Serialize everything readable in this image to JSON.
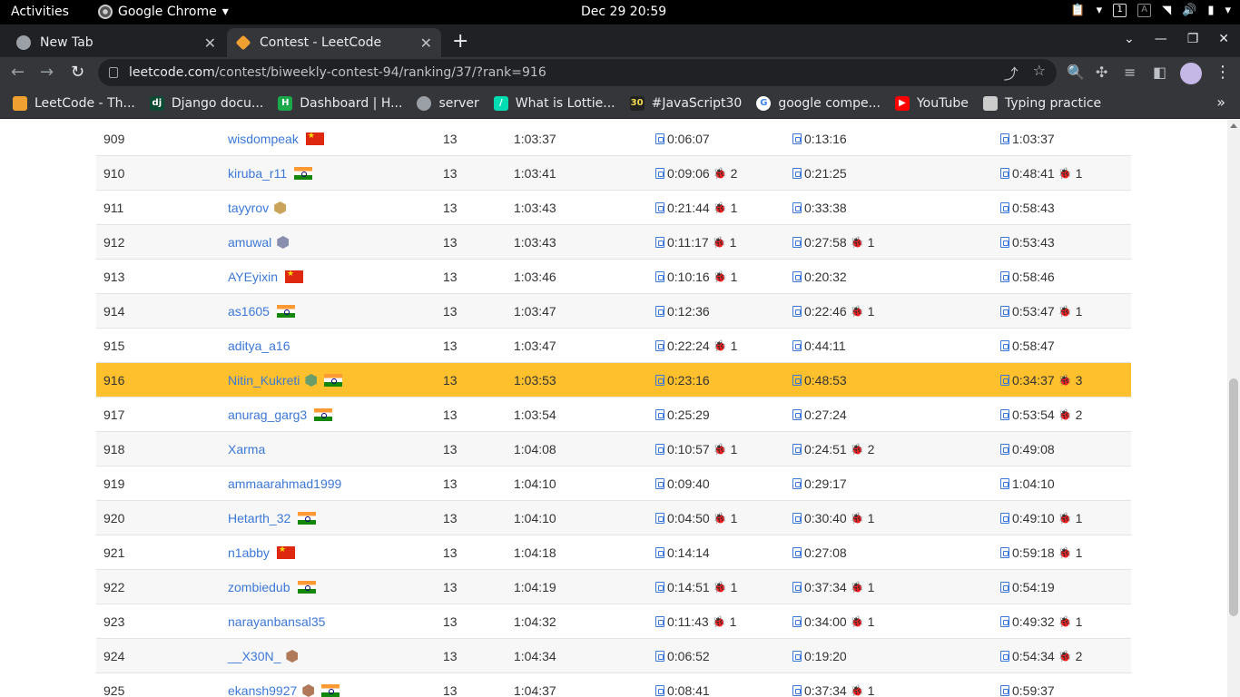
{
  "system_bar": {
    "activities": "Activities",
    "app_name": "Google Chrome",
    "clock": "Dec 29  20:59"
  },
  "tabs": [
    {
      "title": "New Tab"
    },
    {
      "title": "Contest - LeetCode"
    }
  ],
  "address_bar": {
    "host": "leetcode.com",
    "path": "/contest/biweekly-contest-94/ranking/37/?rank=916"
  },
  "bookmarks": [
    {
      "label": "LeetCode - Th...",
      "icon": "leetcode-icon",
      "color": "#f0a030"
    },
    {
      "label": "Django docu...",
      "icon": "django-icon",
      "color": "#0c4b33"
    },
    {
      "label": "Dashboard | H...",
      "icon": "hackerrank-icon",
      "color": "#1ba94c"
    },
    {
      "label": "server",
      "icon": "globe-icon",
      "color": "#9aa0a6"
    },
    {
      "label": "What is Lottie...",
      "icon": "lottie-icon",
      "color": "#00ddb3"
    },
    {
      "label": "#JavaScript30",
      "icon": "js30-icon",
      "color": "#222"
    },
    {
      "label": "google compe...",
      "icon": "google-icon",
      "color": "#ffffff"
    },
    {
      "label": "YouTube",
      "icon": "youtube-icon",
      "color": "#ff0000"
    },
    {
      "label": "Typing practice",
      "icon": "typing-icon",
      "color": "#cccccc"
    }
  ],
  "ranking": [
    {
      "rank": "909",
      "user": "wisdompeak",
      "flag": "cn",
      "badge": "",
      "score": "13",
      "finish": "1:03:37",
      "q1": "0:06:07",
      "q1_bugs": "",
      "q2": "0:13:16",
      "q2_bugs": "",
      "q3": "1:03:37",
      "q3_bugs": ""
    },
    {
      "rank": "910",
      "user": "kiruba_r11",
      "flag": "in",
      "badge": "",
      "score": "13",
      "finish": "1:03:41",
      "q1": "0:09:06",
      "q1_bugs": "2",
      "q2": "0:21:25",
      "q2_bugs": "",
      "q3": "0:48:41",
      "q3_bugs": "1"
    },
    {
      "rank": "911",
      "user": "tayyrov",
      "flag": "",
      "badge": "gold",
      "score": "13",
      "finish": "1:03:43",
      "q1": "0:21:44",
      "q1_bugs": "1",
      "q2": "0:33:38",
      "q2_bugs": "",
      "q3": "0:58:43",
      "q3_bugs": ""
    },
    {
      "rank": "912",
      "user": "amuwal",
      "flag": "",
      "badge": "gray",
      "score": "13",
      "finish": "1:03:43",
      "q1": "0:11:17",
      "q1_bugs": "1",
      "q2": "0:27:58",
      "q2_bugs": "1",
      "q3": "0:53:43",
      "q3_bugs": ""
    },
    {
      "rank": "913",
      "user": "AYEyixin",
      "flag": "cn",
      "badge": "",
      "score": "13",
      "finish": "1:03:46",
      "q1": "0:10:16",
      "q1_bugs": "1",
      "q2": "0:20:32",
      "q2_bugs": "",
      "q3": "0:58:46",
      "q3_bugs": ""
    },
    {
      "rank": "914",
      "user": "as1605",
      "flag": "in",
      "badge": "",
      "score": "13",
      "finish": "1:03:47",
      "q1": "0:12:36",
      "q1_bugs": "",
      "q2": "0:22:46",
      "q2_bugs": "1",
      "q3": "0:53:47",
      "q3_bugs": "1"
    },
    {
      "rank": "915",
      "user": "aditya_a16",
      "flag": "",
      "badge": "",
      "score": "13",
      "finish": "1:03:47",
      "q1": "0:22:24",
      "q1_bugs": "1",
      "q2": "0:44:11",
      "q2_bugs": "",
      "q3": "0:58:47",
      "q3_bugs": ""
    },
    {
      "rank": "916",
      "user": "Nitin_Kukreti",
      "flag": "in",
      "badge": "green",
      "score": "13",
      "finish": "1:03:53",
      "q1": "0:23:16",
      "q1_bugs": "",
      "q2": "0:48:53",
      "q2_bugs": "",
      "q3": "0:34:37",
      "q3_bugs": "3",
      "highlight": true
    },
    {
      "rank": "917",
      "user": "anurag_garg3",
      "flag": "in",
      "badge": "",
      "score": "13",
      "finish": "1:03:54",
      "q1": "0:25:29",
      "q1_bugs": "",
      "q2": "0:27:24",
      "q2_bugs": "",
      "q3": "0:53:54",
      "q3_bugs": "2"
    },
    {
      "rank": "918",
      "user": "Xarma",
      "flag": "",
      "badge": "",
      "score": "13",
      "finish": "1:04:08",
      "q1": "0:10:57",
      "q1_bugs": "1",
      "q2": "0:24:51",
      "q2_bugs": "2",
      "q3": "0:49:08",
      "q3_bugs": ""
    },
    {
      "rank": "919",
      "user": "ammaarahmad1999",
      "flag": "",
      "badge": "",
      "score": "13",
      "finish": "1:04:10",
      "q1": "0:09:40",
      "q1_bugs": "",
      "q2": "0:29:17",
      "q2_bugs": "",
      "q3": "1:04:10",
      "q3_bugs": ""
    },
    {
      "rank": "920",
      "user": "Hetarth_32",
      "flag": "in",
      "badge": "",
      "score": "13",
      "finish": "1:04:10",
      "q1": "0:04:50",
      "q1_bugs": "1",
      "q2": "0:30:40",
      "q2_bugs": "1",
      "q3": "0:49:10",
      "q3_bugs": "1"
    },
    {
      "rank": "921",
      "user": "n1abby",
      "flag": "cn",
      "badge": "",
      "score": "13",
      "finish": "1:04:18",
      "q1": "0:14:14",
      "q1_bugs": "",
      "q2": "0:27:08",
      "q2_bugs": "",
      "q3": "0:59:18",
      "q3_bugs": "1"
    },
    {
      "rank": "922",
      "user": "zombiedub",
      "flag": "in",
      "badge": "",
      "score": "13",
      "finish": "1:04:19",
      "q1": "0:14:51",
      "q1_bugs": "1",
      "q2": "0:37:34",
      "q2_bugs": "1",
      "q3": "0:54:19",
      "q3_bugs": ""
    },
    {
      "rank": "923",
      "user": "narayanbansal35",
      "flag": "",
      "badge": "",
      "score": "13",
      "finish": "1:04:32",
      "q1": "0:11:43",
      "q1_bugs": "1",
      "q2": "0:34:00",
      "q2_bugs": "1",
      "q3": "0:49:32",
      "q3_bugs": "1"
    },
    {
      "rank": "924",
      "user": "__X30N_",
      "flag": "",
      "badge": "bronze",
      "score": "13",
      "finish": "1:04:34",
      "q1": "0:06:52",
      "q1_bugs": "",
      "q2": "0:19:20",
      "q2_bugs": "",
      "q3": "0:54:34",
      "q3_bugs": "2"
    },
    {
      "rank": "925",
      "user": "ekansh9927",
      "flag": "in",
      "badge": "bronze",
      "score": "13",
      "finish": "1:04:37",
      "q1": "0:08:41",
      "q1_bugs": "",
      "q2": "0:37:34",
      "q2_bugs": "1",
      "q3": "0:59:37",
      "q3_bugs": ""
    }
  ],
  "colors": {
    "highlight_row": "#ffc02e",
    "link": "#3c78d8",
    "bug": "#e0242b"
  }
}
